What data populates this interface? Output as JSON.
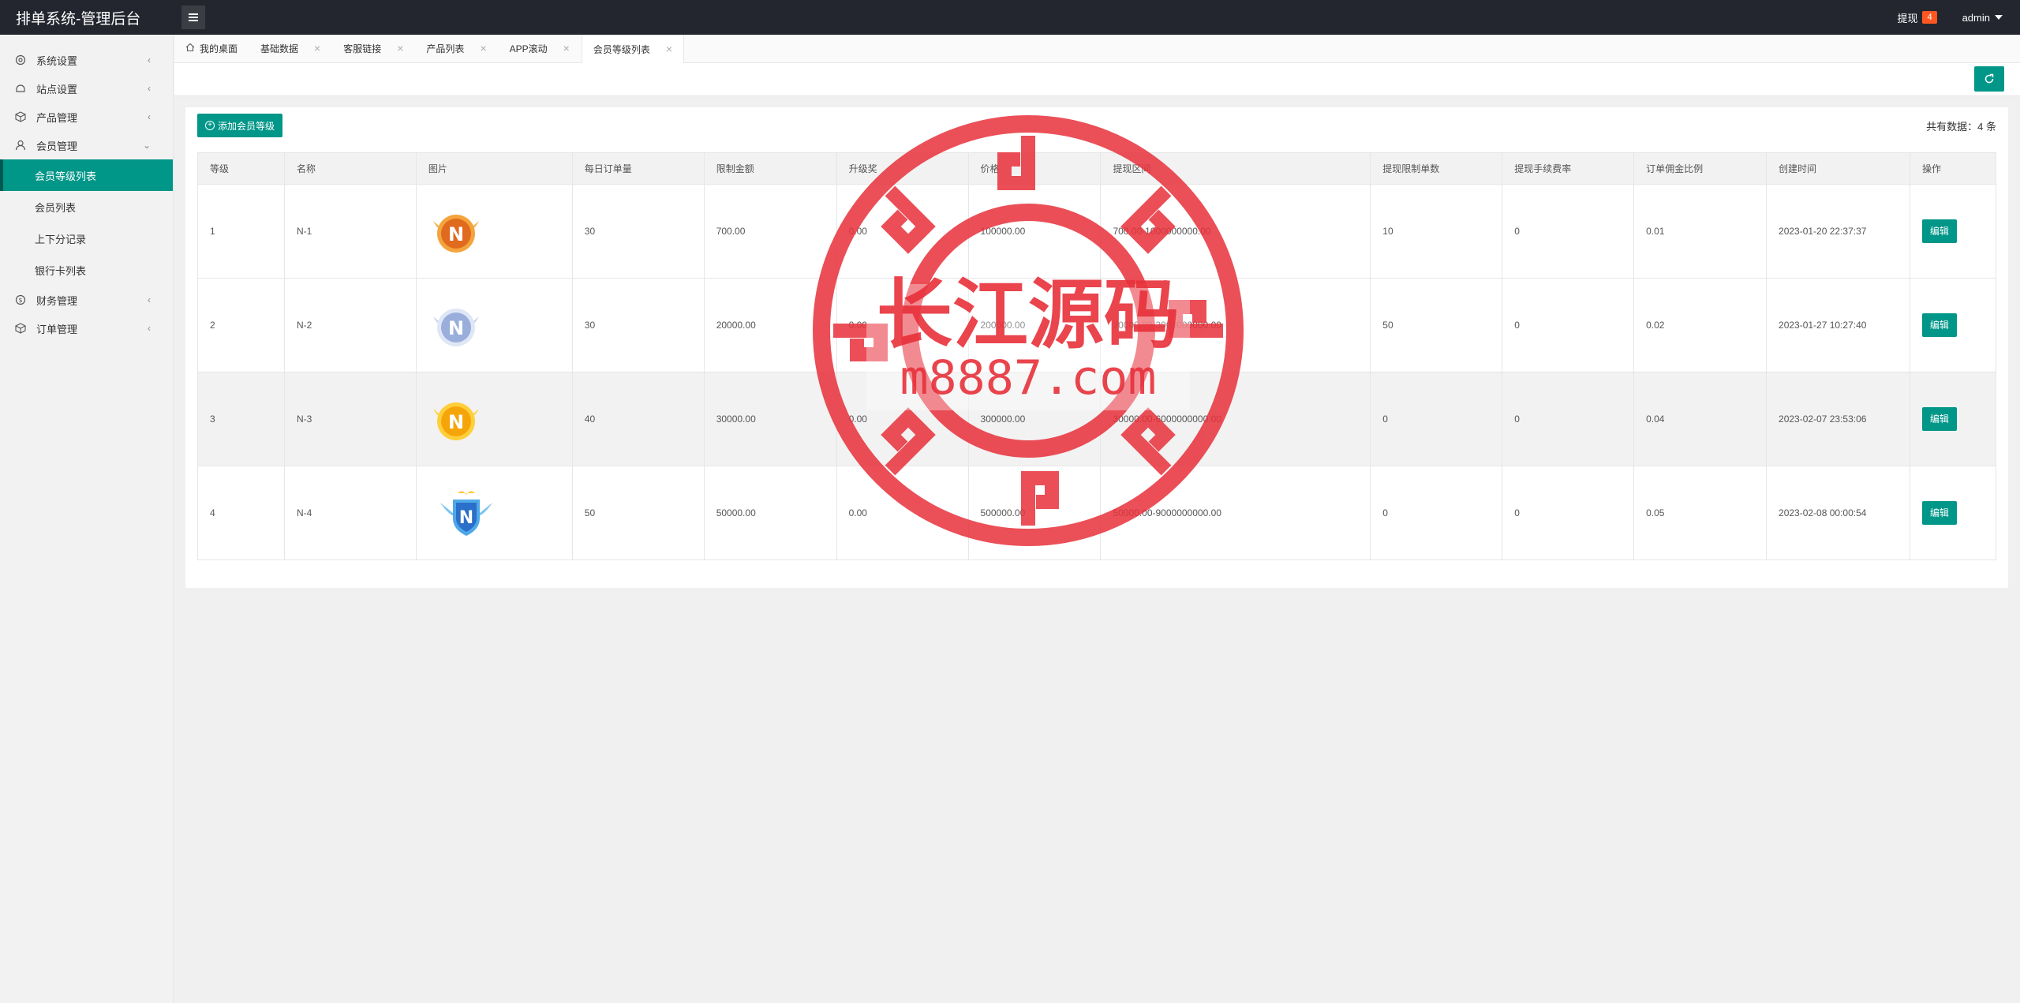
{
  "header": {
    "title": "排单系统-管理后台",
    "withdraw_label": "提现",
    "withdraw_badge": "4",
    "user_name": "admin"
  },
  "sidebar": {
    "items": [
      {
        "label": "系统设置",
        "icon": "gear-icon"
      },
      {
        "label": "站点设置",
        "icon": "site-icon"
      },
      {
        "label": "产品管理",
        "icon": "box-icon"
      },
      {
        "label": "会员管理",
        "icon": "user-icon"
      },
      {
        "label": "财务管理",
        "icon": "money-icon"
      },
      {
        "label": "订单管理",
        "icon": "order-icon"
      }
    ],
    "member_sub": [
      {
        "label": "会员等级列表",
        "active": true
      },
      {
        "label": "会员列表"
      },
      {
        "label": "上下分记录"
      },
      {
        "label": "银行卡列表"
      }
    ]
  },
  "tabs": [
    {
      "label": "我的桌面"
    },
    {
      "label": "基础数据"
    },
    {
      "label": "客服链接"
    },
    {
      "label": "产品列表"
    },
    {
      "label": "APP滚动"
    },
    {
      "label": "会员等级列表"
    }
  ],
  "toolbar": {
    "add_label": "添加会员等级",
    "total_text": "共有数据：4 条"
  },
  "table": {
    "headers": [
      "等级",
      "名称",
      "图片",
      "每日订单量",
      "限制金额",
      "升级奖",
      "价格",
      "提现区间",
      "提现限制单数",
      "提现手续费率",
      "订单佣金比例",
      "创建时间",
      "操作"
    ],
    "rows": [
      {
        "level": "1",
        "name": "N-1",
        "image": "bronze-n-badge",
        "daily_orders": "30",
        "limit_amount": "700.00",
        "upgrade_reward": "0.00",
        "price": "100000.00",
        "withdraw_range": "700.00-1000000000.00",
        "withdraw_limit": "10",
        "fee_rate": "0",
        "commission": "0.01",
        "created": "2023-01-20 22:37:37",
        "action": "编辑"
      },
      {
        "level": "2",
        "name": "N-2",
        "image": "silver-n-badge",
        "daily_orders": "30",
        "limit_amount": "20000.00",
        "upgrade_reward": "0.00",
        "price": "200000.00",
        "withdraw_range": "20000.00-3000000000.00",
        "withdraw_limit": "50",
        "fee_rate": "0",
        "commission": "0.02",
        "created": "2023-01-27 10:27:40",
        "action": "编辑"
      },
      {
        "level": "3",
        "name": "N-3",
        "image": "gold-n-badge",
        "daily_orders": "40",
        "limit_amount": "30000.00",
        "upgrade_reward": "0.00",
        "price": "300000.00",
        "withdraw_range": "30000.00-6000000000.00",
        "withdraw_limit": "0",
        "fee_rate": "0",
        "commission": "0.04",
        "created": "2023-02-07 23:53:06",
        "action": "编辑"
      },
      {
        "level": "4",
        "name": "N-4",
        "image": "diamond-n-badge",
        "daily_orders": "50",
        "limit_amount": "50000.00",
        "upgrade_reward": "0.00",
        "price": "500000.00",
        "withdraw_range": "50000.00-9000000000.00",
        "withdraw_limit": "0",
        "fee_rate": "0",
        "commission": "0.05",
        "created": "2023-02-08 00:00:54",
        "action": "编辑"
      }
    ]
  },
  "watermark": {
    "line1": "长江源码",
    "line2": "m8887.com",
    "color": "#e8303a"
  }
}
